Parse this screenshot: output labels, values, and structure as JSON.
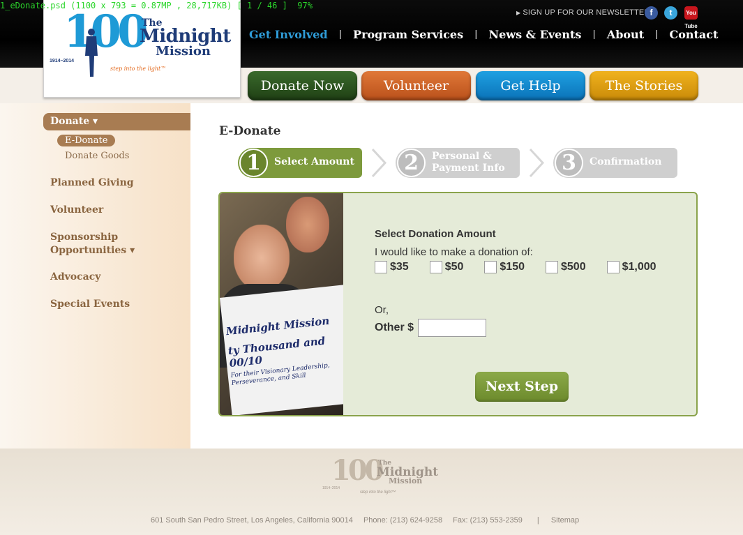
{
  "viewer": {
    "caption": "1_eDonate.psd (1100 x 793 = 0.87MP , 28,717KB) [ 1 / 46 ]  97%"
  },
  "brand": {
    "logo_number": "100",
    "logo_the": "The",
    "logo_midnight": "Midnight",
    "logo_mission": "Mission",
    "logo_years": "1914–2014",
    "logo_tagline": "step into the light™"
  },
  "header": {
    "newsletter": "SIGN UP FOR OUR NEWSLETTER",
    "social": {
      "facebook": "f",
      "twitter": "t",
      "youtube": "You Tube"
    },
    "nav": [
      "Get Involved",
      "Program Services",
      "News & Events",
      "About",
      "Contact"
    ]
  },
  "actions": {
    "donate": "Donate Now",
    "volunteer": "Volunteer",
    "help": "Get Help",
    "stories": "The Stories"
  },
  "sidebar": {
    "donate": "Donate",
    "sub_active": "E-Donate",
    "sub_goods": "Donate Goods",
    "planned": "Planned Giving",
    "volunteer": "Volunteer",
    "sponsorship_1": "Sponsorship",
    "sponsorship_2": "Opportunities",
    "advocacy": "Advocacy",
    "events": "Special Events"
  },
  "main": {
    "title": "E-Donate",
    "steps": [
      {
        "num": "1",
        "label_1": "Select Amount",
        "label_2": ""
      },
      {
        "num": "2",
        "label_1": "Personal &",
        "label_2": "Payment Info"
      },
      {
        "num": "3",
        "label_1": "Confirmation",
        "label_2": ""
      }
    ],
    "photo_check": {
      "line1": "Midnight Mission",
      "line2": "ty Thousand and 00/10",
      "line3a": "For their Visionary Leadership,",
      "line3b": "Perseverance, and Skill"
    },
    "form": {
      "heading": "Select Donation Amount",
      "lead": "I would like to make a donation of:",
      "amounts": [
        "$35",
        "$50",
        "$150",
        "$500",
        "$1,000"
      ],
      "or": "Or,",
      "other_label": "Other $",
      "other_value": "",
      "next": "Next Step"
    }
  },
  "footer": {
    "address": "601 South San Pedro Street, Los Angeles, California 90014",
    "phone": "Phone: (213) 624-9258",
    "fax": "Fax: (213) 553-2359",
    "sitemap": "Sitemap",
    "logo_number": "100",
    "logo_the": "The",
    "logo_midnight": "Midnight",
    "logo_mission": "Mission",
    "logo_years": "1914–2014",
    "logo_tagline": "step into the light™"
  }
}
